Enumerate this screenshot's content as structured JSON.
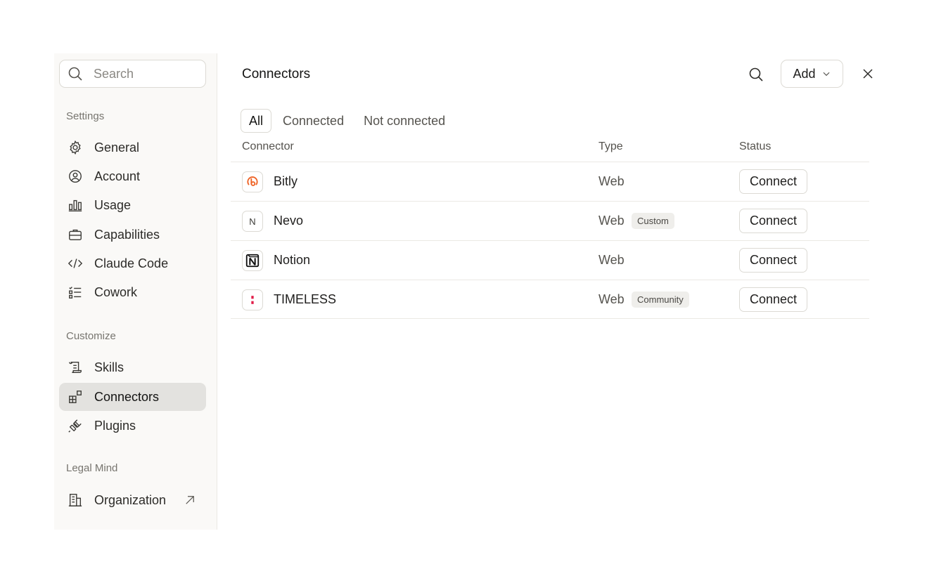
{
  "sidebar": {
    "search_placeholder": "Search",
    "sections": {
      "settings": "Settings",
      "customize": "Customize",
      "org": "Legal Mind"
    },
    "items": [
      {
        "label": "General",
        "icon": "gear-icon"
      },
      {
        "label": "Account",
        "icon": "user-circle-icon"
      },
      {
        "label": "Usage",
        "icon": "bar-chart-icon"
      },
      {
        "label": "Capabilities",
        "icon": "briefcase-icon"
      },
      {
        "label": "Claude Code",
        "icon": "code-icon"
      },
      {
        "label": "Cowork",
        "icon": "checklist-icon"
      },
      {
        "label": "Skills",
        "icon": "scroll-icon"
      },
      {
        "label": "Connectors",
        "icon": "grid-plus-icon",
        "active": true
      },
      {
        "label": "Plugins",
        "icon": "plug-icon"
      },
      {
        "label": "Organization",
        "icon": "building-icon",
        "external": true
      }
    ]
  },
  "main": {
    "title": "Connectors",
    "add_label": "Add",
    "tabs": [
      "All",
      "Connected",
      "Not connected"
    ],
    "active_tab": "All",
    "columns": [
      "Connector",
      "Type",
      "Status"
    ],
    "connectors": [
      {
        "name": "Bitly",
        "type": "Web",
        "badge": "",
        "action": "Connect",
        "logo": "bitly-logo-icon"
      },
      {
        "name": "Nevo",
        "type": "Web",
        "badge": "Custom",
        "action": "Connect",
        "logo": "N"
      },
      {
        "name": "Notion",
        "type": "Web",
        "badge": "",
        "action": "Connect",
        "logo": "notion-logo-icon"
      },
      {
        "name": "TIMELESS",
        "type": "Web",
        "badge": "Community",
        "action": "Connect",
        "logo": "timeless-logo-icon"
      }
    ]
  },
  "colors": {
    "accent_active_bg": "#e3e2df",
    "bitly_orange": "#ee6123",
    "timeless_red": "#e11d48"
  }
}
